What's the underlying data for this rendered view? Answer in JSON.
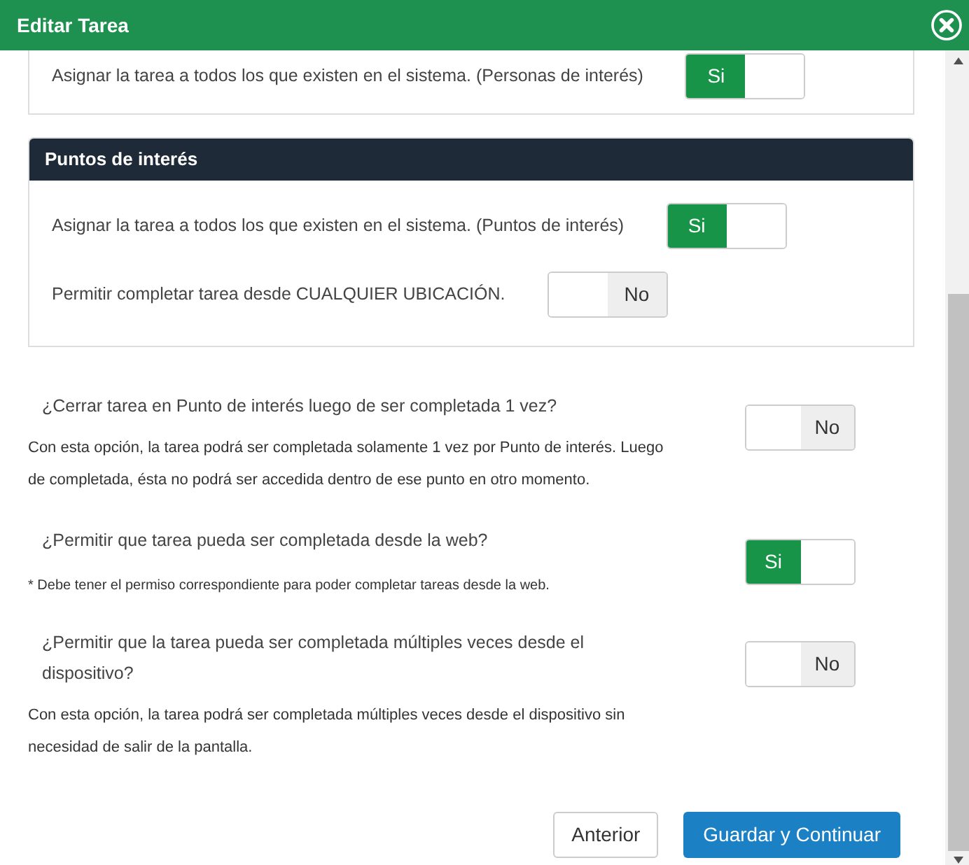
{
  "window": {
    "title": "Editar Tarea"
  },
  "top_card": {
    "rows": [
      {
        "label": "Asignar la tarea a todos los que existen en el sistema. (Personas de interés)",
        "toggle": {
          "on": true,
          "label": "Si"
        }
      }
    ]
  },
  "panel": {
    "title": "Puntos de interés",
    "rows": [
      {
        "label": "Asignar la tarea a todos los que existen en el sistema. (Puntos de interés)",
        "toggle": {
          "on": true,
          "label": "Si"
        }
      },
      {
        "label": "Permitir completar tarea desde CUALQUIER UBICACIÓN.",
        "toggle": {
          "on": false,
          "label": "No"
        }
      }
    ]
  },
  "questions": [
    {
      "question": "¿Cerrar tarea en Punto de interés luego de ser completada 1 vez?",
      "toggle": {
        "on": false,
        "label": "No"
      },
      "description": "Con esta opción, la tarea podrá ser completada solamente 1 vez por Punto de interés. Luego de completada, ésta no podrá ser accedida dentro de ese punto en otro momento."
    },
    {
      "question": "¿Permitir que tarea pueda ser completada desde la web?",
      "toggle": {
        "on": true,
        "label": "Si"
      },
      "note": "* Debe tener el permiso correspondiente para poder completar tareas desde la web."
    },
    {
      "question": "¿Permitir que la tarea pueda ser completada múltiples veces desde el dispositivo?",
      "toggle": {
        "on": false,
        "label": "No"
      },
      "description": "Con esta opción, la tarea podrá ser completada múltiples veces desde el dispositivo sin necesidad de salir de la pantalla."
    }
  ],
  "buttons": [
    {
      "label": "Anterior",
      "kind": "secondary"
    },
    {
      "label": "Guardar y Continuar",
      "kind": "primary"
    }
  ]
}
